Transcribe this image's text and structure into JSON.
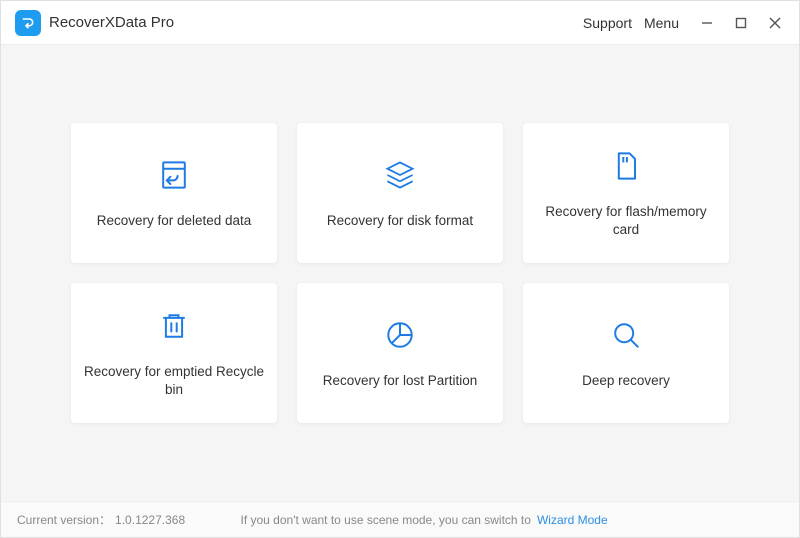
{
  "app": {
    "title": "RecoverXData Pro",
    "support_label": "Support",
    "menu_label": "Menu"
  },
  "cards": [
    {
      "icon": "file-restore",
      "label": "Recovery for deleted data"
    },
    {
      "icon": "disk-stack",
      "label": "Recovery for disk format"
    },
    {
      "icon": "sd-card",
      "label": "Recovery for flash/memory card"
    },
    {
      "icon": "trash",
      "label": "Recovery for emptied Recycle bin"
    },
    {
      "icon": "partition",
      "label": "Recovery for lost Partition"
    },
    {
      "icon": "magnify",
      "label": "Deep recovery"
    }
  ],
  "footer": {
    "version_label": "Current version：",
    "version": "1.0.1227.368",
    "switch_text": "If you don't want to use scene mode, you can switch to",
    "wizard_label": "Wizard Mode"
  },
  "colors": {
    "accent": "#1e7be6",
    "logo_bg": "#1e9cf0"
  }
}
